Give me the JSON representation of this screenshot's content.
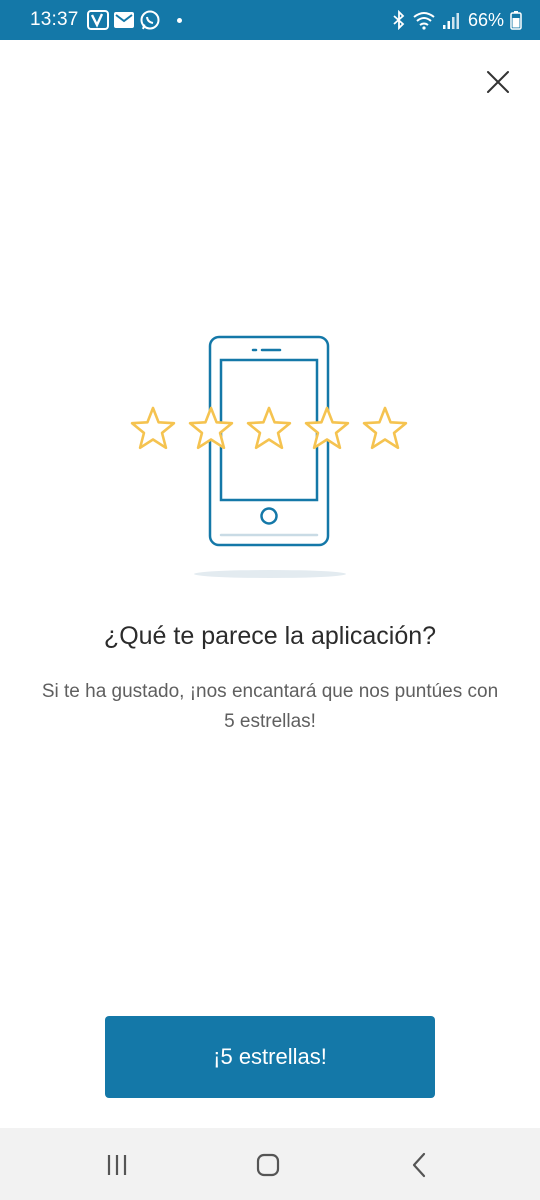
{
  "status_bar": {
    "time": "13:37",
    "battery": "66%",
    "icons_left": [
      "v-app-icon",
      "mail-icon",
      "whatsapp-icon",
      "notification-dot"
    ],
    "icons_right": [
      "bluetooth-icon",
      "wifi-icon",
      "signal-icon",
      "battery-icon"
    ]
  },
  "dialog": {
    "title": "¿Qué te parece la aplicación?",
    "subtitle": "Si te ha gustado, ¡nos encantará que nos puntúes con 5 estrellas!",
    "button_label": "¡5 estrellas!",
    "star_count": 5
  },
  "colors": {
    "primary": "#1478a8",
    "star": "#f5c350",
    "phone_outline": "#1478a8",
    "nav_bar_bg": "#f2f2f2"
  },
  "nav_bar": {
    "buttons": [
      "recent-apps-icon",
      "home-icon",
      "back-icon"
    ]
  }
}
